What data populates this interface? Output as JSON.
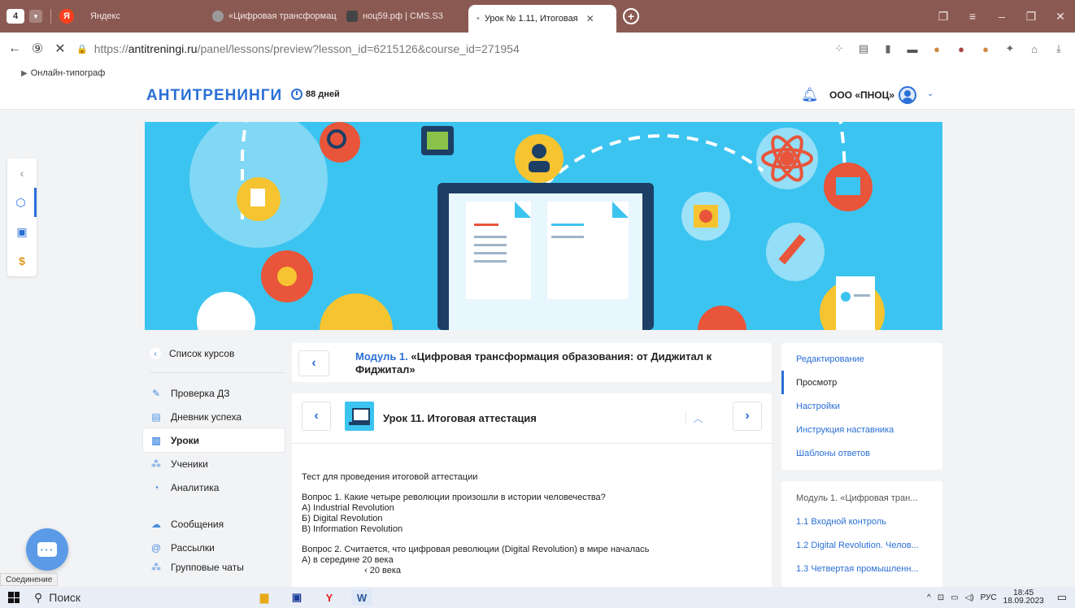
{
  "browser": {
    "tab_count": "4",
    "tabs": [
      {
        "label": "Яндекс",
        "color": "#fc3f1d"
      },
      {
        "label": "«Цифровая трансформац",
        "color": "#7d7d7d"
      },
      {
        "label": "ноц59.рф | CMS.S3",
        "color": "#333333"
      },
      {
        "label": "Урок № 1.11, Итоговая",
        "color": "#ffffff"
      }
    ],
    "url_host": "antitreningi.ru",
    "url_prefix": "https://",
    "url_path": "/panel/lessons/preview?lesson_id=6215126&course_id=271954",
    "bookmark": "Онлайн-типограф"
  },
  "header": {
    "logo": "АНТИТРЕНИНГИ",
    "days": "88 дней",
    "org": "ООО «ПНОЦ»"
  },
  "sidenav": {
    "back": "Список курсов",
    "items": [
      {
        "label": "Проверка ДЗ",
        "icon": "edit-icon"
      },
      {
        "label": "Дневник успеха",
        "icon": "diary-icon"
      },
      {
        "label": "Уроки",
        "icon": "book-icon"
      },
      {
        "label": "Ученики",
        "icon": "users-icon"
      },
      {
        "label": "Аналитика",
        "icon": "chart-icon"
      },
      {
        "label": "Сообщения",
        "icon": "messages-icon"
      },
      {
        "label": "Рассылки",
        "icon": "at-icon"
      },
      {
        "label": "Групповые чаты",
        "icon": "group-icon"
      }
    ]
  },
  "module": {
    "number": "Модуль 1.",
    "title": "«Цифровая трансформация образования: от Диджитал к Фиджитал»"
  },
  "lesson": {
    "title": "Урок 11. Итоговая аттестация",
    "intro": "Тест для проведения итоговой аттестации",
    "q1": "Вопрос 1. Какие четыре революции произошли в истории человечества?",
    "q1a": "А) Industrial Revolution",
    "q1b": "Б) Digital Revolution",
    "q1c": "В) Information Revolution",
    "q2": "Вопрос 2. Считается, что цифровая революции (Digital Revolution) в мире началась",
    "q2a": "А) в середине 20 века",
    "q2b": "‹ 20 века"
  },
  "right_panel": {
    "items": [
      "Редактирование",
      "Просмотр",
      "Настройки",
      "Инструкция наставника",
      "Шаблоны ответов"
    ]
  },
  "toc": {
    "items": [
      "Модуль 1. «Цифровая тран...",
      "1.1 Входной контроль",
      "1.2 Digital Revolution. Челов...",
      "1.3 Четвертая промышленн..."
    ]
  },
  "status": "Соединение",
  "taskbar": {
    "search": "Поиск",
    "lang": "РУС",
    "time": "18:45",
    "date": "18.09.2023"
  }
}
